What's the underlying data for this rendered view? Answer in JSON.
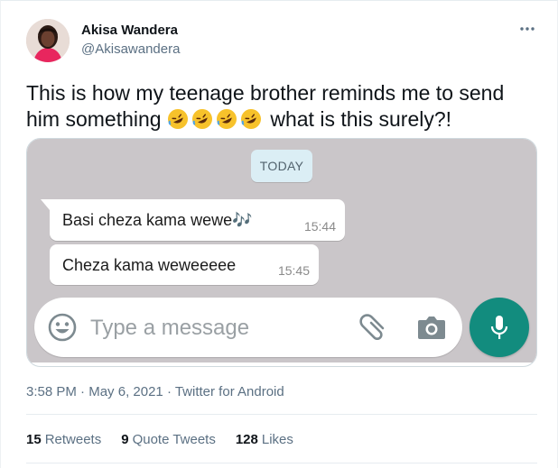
{
  "author": {
    "display_name": "Akisa Wandera",
    "handle": "@Akisawandera"
  },
  "tweet": {
    "text_before_emoji": "This is how my teenage brother reminds me to send him something ",
    "emoji_count": 4,
    "emoji_name": "rolling-on-floor-laughing-emoji",
    "text_after_emoji": "what is this surely?!"
  },
  "chat": {
    "date_chip": "TODAY",
    "messages": [
      {
        "text": "Basi cheza kama wewe",
        "suffix": "🎶",
        "time": "15:44"
      },
      {
        "text": "Cheza kama weweeeee",
        "suffix": "",
        "time": "15:45"
      }
    ],
    "input_placeholder": "Type a message",
    "colors": {
      "background": "#cac6c9",
      "mic": "#128c7e",
      "date_chip": "#dbeef5"
    }
  },
  "meta": {
    "time": "3:58 PM",
    "separator": " · ",
    "date": "May 6, 2021",
    "source": "Twitter for Android"
  },
  "stats": {
    "retweets_count": "15",
    "retweets_label": "Retweets",
    "quotes_count": "9",
    "quotes_label": "Quote Tweets",
    "likes_count": "128",
    "likes_label": "Likes"
  },
  "icons": [
    "more-icon",
    "emoji-picker-icon",
    "attach-icon",
    "camera-icon",
    "mic-icon"
  ]
}
